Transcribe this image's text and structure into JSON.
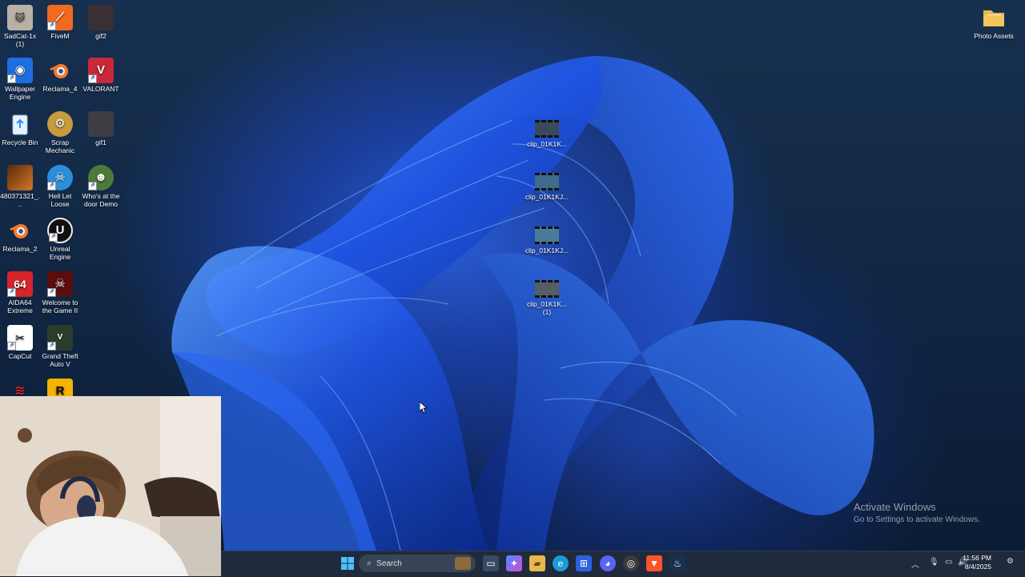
{
  "desktop_icons": [
    {
      "label": "SadCat-1x (1)",
      "icon": "sadcat-image-icon"
    },
    {
      "label": "FiveM",
      "icon": "fivem-icon"
    },
    {
      "label": "gif2",
      "icon": "gif-image-icon"
    },
    {
      "label": "Wallpaper Engine",
      "icon": "wallpaper-engine-icon"
    },
    {
      "label": "Reclama_4",
      "icon": "blender-icon"
    },
    {
      "label": "VALORANT",
      "icon": "valorant-icon"
    },
    {
      "label": "Recycle Bin",
      "icon": "recycle-bin-icon"
    },
    {
      "label": "Scrap Mechanic",
      "icon": "scrap-mechanic-icon"
    },
    {
      "label": "gif1",
      "icon": "gif-image-icon"
    },
    {
      "label": "480371321_...",
      "icon": "image-file-icon"
    },
    {
      "label": "Hell Let Loose",
      "icon": "hell-let-loose-icon"
    },
    {
      "label": "Who's at the door Demo",
      "icon": "game-icon"
    },
    {
      "label": "Reclama_2",
      "icon": "blender-icon"
    },
    {
      "label": "Unreal Engine",
      "icon": "unreal-engine-icon"
    },
    {
      "label": "AIDA64 Extreme",
      "icon": "aida64-icon"
    },
    {
      "label": "Welcome to the Game II",
      "icon": "skull-game-icon"
    },
    {
      "label": "CapCut",
      "icon": "capcut-icon"
    },
    {
      "label": "Grand Theft Auto V",
      "icon": "gta-icon"
    }
  ],
  "partial_icons": [
    {
      "icon": "assetto-corsa-icon"
    },
    {
      "icon": "rockstar-launcher-icon",
      "glyph": "R"
    }
  ],
  "right_icons": [
    {
      "label": "Photo Assets",
      "icon": "folder-icon"
    }
  ],
  "clips": [
    {
      "label": "clip_01K1K..."
    },
    {
      "label": "clip_01K1KJ..."
    },
    {
      "label": "clip_01K1KJ..."
    },
    {
      "label": "clip_01K1K...",
      "badge": "(1)"
    }
  ],
  "watermark": {
    "title": "Activate Windows",
    "subtitle": "Go to Settings to activate Windows."
  },
  "taskbar": {
    "search_label": "Search",
    "apps": [
      "start-icon",
      "task-view-icon",
      "copilot-icon",
      "file-explorer-icon",
      "edge-icon",
      "store-icon",
      "discord-icon",
      "chrome-icon",
      "brave-icon",
      "steam-icon"
    ],
    "clock_time": "11:56 PM",
    "clock_date": "8/4/2025"
  },
  "colors": {
    "taskbar_bg": "#1f2a3d",
    "accent": "#2a62e0"
  }
}
